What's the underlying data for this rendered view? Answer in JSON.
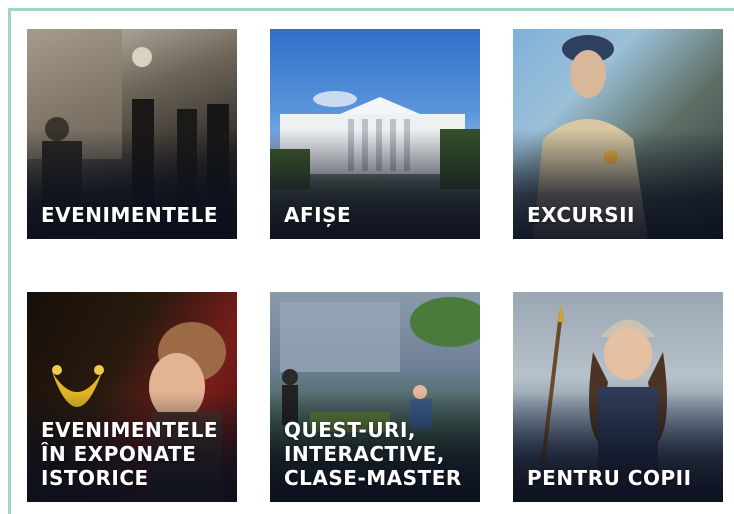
{
  "tiles": [
    {
      "label": "EVENIMENTELE"
    },
    {
      "label": "AFIȘE"
    },
    {
      "label": "EXCURSII"
    },
    {
      "label": "EVENIMENTELE\nÎN EXPONATE\nISTORICE"
    },
    {
      "label": "QUEST-URI,\nINTERACTIVE,\nCLASE-MASTER"
    },
    {
      "label": "PENTRU COPII"
    }
  ],
  "colors": {
    "frame_border": "#9fd8c4",
    "label_text": "#ffffff"
  }
}
